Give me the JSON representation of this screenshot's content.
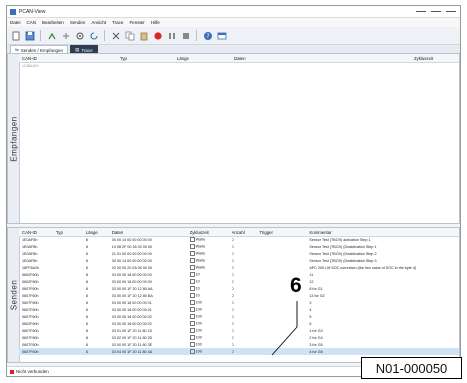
{
  "window": {
    "title": "PCAN-View"
  },
  "menu": [
    "Datei",
    "CAN",
    "Bearbeiten",
    "Senden",
    "Ansicht",
    "Trace",
    "Fenster",
    "Hilfe"
  ],
  "toolbar": {
    "icons": [
      "new-icon",
      "save-icon",
      "connect-icon",
      "disconnect-icon",
      "settings-icon",
      "refresh-icon",
      "cut-icon",
      "copy-icon",
      "paste-icon",
      "record-icon",
      "pause-icon",
      "stop-icon",
      "help-icon",
      "window-icon"
    ]
  },
  "tabs": [
    {
      "label": "Senden / Empfangen",
      "active": true
    },
    {
      "label": "Trace",
      "active": false
    }
  ],
  "receive": {
    "side_label": "Empfangen",
    "columns": [
      "CAN-ID",
      "Typ",
      "Länge",
      "Daten",
      "Zykluszeit"
    ],
    "rows": [
      {
        "id": "<CAN-ID>"
      }
    ]
  },
  "transmit": {
    "side_label": "Senden",
    "columns": [
      "CAN-ID",
      "Typ",
      "Länge",
      "Daten",
      "Zykluszeit",
      "Anzahl",
      "Trigger",
      "Kommentar"
    ],
    "rows": [
      {
        "id": "1E0AF8h",
        "typ": "",
        "len": "8",
        "data": "00 00 14 00 00 00 00 00",
        "cycle": "Warte",
        "count": "0",
        "trigger": "",
        "comment": "Sensor Test (TBOX) activation Step 1"
      },
      {
        "id": "1E0AF8h",
        "typ": "",
        "len": "8",
        "data": "10 08 2F 00 18 03 00 00",
        "cycle": "Warte",
        "count": "0",
        "trigger": "",
        "comment": "Sensor Test (TBOX) (Deaktivation Step 1"
      },
      {
        "id": "1E0AF8h",
        "typ": "",
        "len": "8",
        "data": "21 01 00 00 00 00 00 00",
        "cycle": "Warte",
        "count": "0",
        "trigger": "",
        "comment": "Sensor Test (TBOX) (Deaktivation Step 2"
      },
      {
        "id": "1E0AF8h",
        "typ": "",
        "len": "8",
        "data": "30 00 14 00 00 00 00 00",
        "cycle": "Warte",
        "count": "0",
        "trigger": "",
        "comment": "Sensor Test (TBOX) (Deaktivation Step 3"
      },
      {
        "id": "18FF6A2h",
        "typ": "",
        "len": "8",
        "data": "02 00 00 20 0A 05 00 00",
        "cycle": "Warte",
        "count": "0",
        "trigger": "",
        "comment": "APC 200 LM SOC correction (the hex value of SOC in the byte 4)"
      },
      {
        "id": "0602F60h",
        "typ": "",
        "len": "8",
        "data": "03 00 00 18 00 00 00 03",
        "cycle": "10",
        "count": "0",
        "trigger": "",
        "comment": "11"
      },
      {
        "id": "0602F60h",
        "typ": "",
        "len": "8",
        "data": "03 00 00 18 00 00 00 00",
        "cycle": "10",
        "count": "0",
        "trigger": "",
        "comment": "12"
      },
      {
        "id": "0607F60h",
        "typ": "",
        "len": "8",
        "data": "03 00 00 1F 20 12 80 AA",
        "cycle": "10",
        "count": "0",
        "trigger": "",
        "comment": "8 for G1"
      },
      {
        "id": "0607F60h",
        "typ": "",
        "len": "8",
        "data": "03 00 00 1F 20 12 80 BA",
        "cycle": "10",
        "count": "0",
        "trigger": "",
        "comment": "13 for G2"
      },
      {
        "id": "0607F60h",
        "typ": "",
        "len": "8",
        "data": "03 00 00 18 00 00 00 01",
        "cycle": "100",
        "count": "0",
        "trigger": "",
        "comment": "3"
      },
      {
        "id": "0607F60h",
        "typ": "",
        "len": "8",
        "data": "03 00 00 18 00 00 00 01",
        "cycle": "100",
        "count": "0",
        "trigger": "",
        "comment": "4"
      },
      {
        "id": "0607F60h",
        "typ": "",
        "len": "8",
        "data": "03 00 00 18 00 00 00 02",
        "cycle": "100",
        "count": "0",
        "trigger": "",
        "comment": "5"
      },
      {
        "id": "0602F60h",
        "typ": "",
        "len": "8",
        "data": "03 00 00 18 00 00 00 02",
        "cycle": "100",
        "count": "0",
        "trigger": "",
        "comment": "6"
      },
      {
        "id": "0607F60h",
        "typ": "",
        "len": "8",
        "data": "03 01 00 1F 20 11 80 1D",
        "cycle": "100",
        "count": "0",
        "trigger": "",
        "comment": "1 for G3"
      },
      {
        "id": "0607F60h",
        "typ": "",
        "len": "8",
        "data": "03 02 00 1F 20 11 80 2D",
        "cycle": "100",
        "count": "0",
        "trigger": "",
        "comment": "2 for G4"
      },
      {
        "id": "0607F60h",
        "typ": "",
        "len": "8",
        "data": "03 00 00 1F 20 11 80 3E",
        "cycle": "100",
        "count": "0",
        "trigger": "",
        "comment": "3 for G5"
      },
      {
        "id": "0607F60h",
        "typ": "",
        "len": "8",
        "data": "03 04 00 1F 20 11 80 4A",
        "cycle": "100",
        "count": "0",
        "trigger": "",
        "comment": "4 for G6"
      }
    ]
  },
  "status": {
    "text": "Nicht verbunden"
  },
  "annotation": {
    "callout": "6",
    "reference": "N01-000050"
  },
  "colors": {
    "accent": "#3b6fb6",
    "selection": "#cfe3f7",
    "status_dot": "#d22222"
  }
}
